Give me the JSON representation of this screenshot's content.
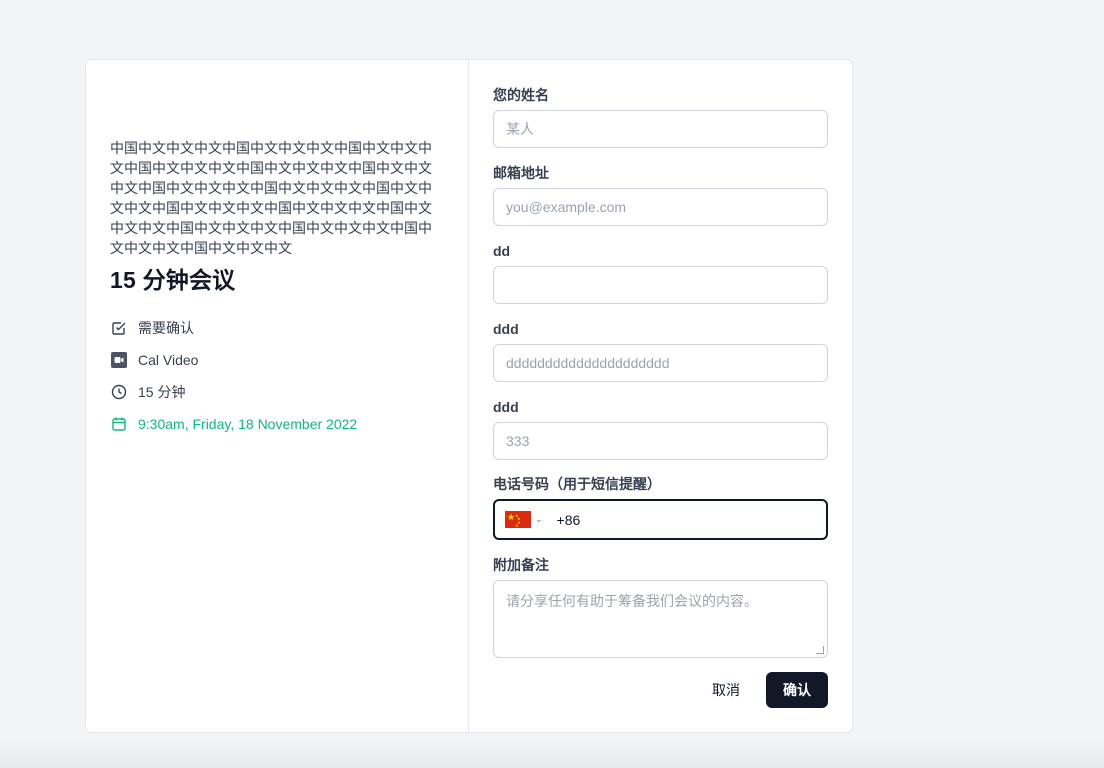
{
  "event": {
    "description": "中国中文中文中文中国中文中文中文中国中文中文中文中国中文中文中文中国中文中文中文中国中文中文中文中国中文中文中文中国中文中文中文中国中文中文中文中国中文中文中文中国中文中文中文中国中文中文中文中国中文中文中文中国中文中文中文中国中文中文中文中国中文中文中文",
    "title": "15 分钟会议",
    "meta": {
      "confirmation": "需要确认",
      "location": "Cal Video",
      "duration": "15 分钟",
      "datetime": "9:30am, Friday, 18 November 2022"
    },
    "accent_color": "#10b981"
  },
  "form": {
    "name": {
      "label": "您的姓名",
      "placeholder": "某人"
    },
    "email": {
      "label": "邮箱地址",
      "placeholder": "you@example.com"
    },
    "dd": {
      "label": "dd",
      "placeholder": ""
    },
    "ddd1": {
      "label": "ddd",
      "placeholder": "ddddddddddddddddddddd"
    },
    "ddd2": {
      "label": "ddd",
      "placeholder": "333"
    },
    "phone": {
      "label": "电话号码（用于短信提醒）",
      "value": "+86",
      "country": "CN"
    },
    "notes": {
      "label": "附加备注",
      "placeholder": "请分享任何有助于筹备我们会议的内容。"
    }
  },
  "actions": {
    "cancel": "取消",
    "confirm": "确认"
  }
}
